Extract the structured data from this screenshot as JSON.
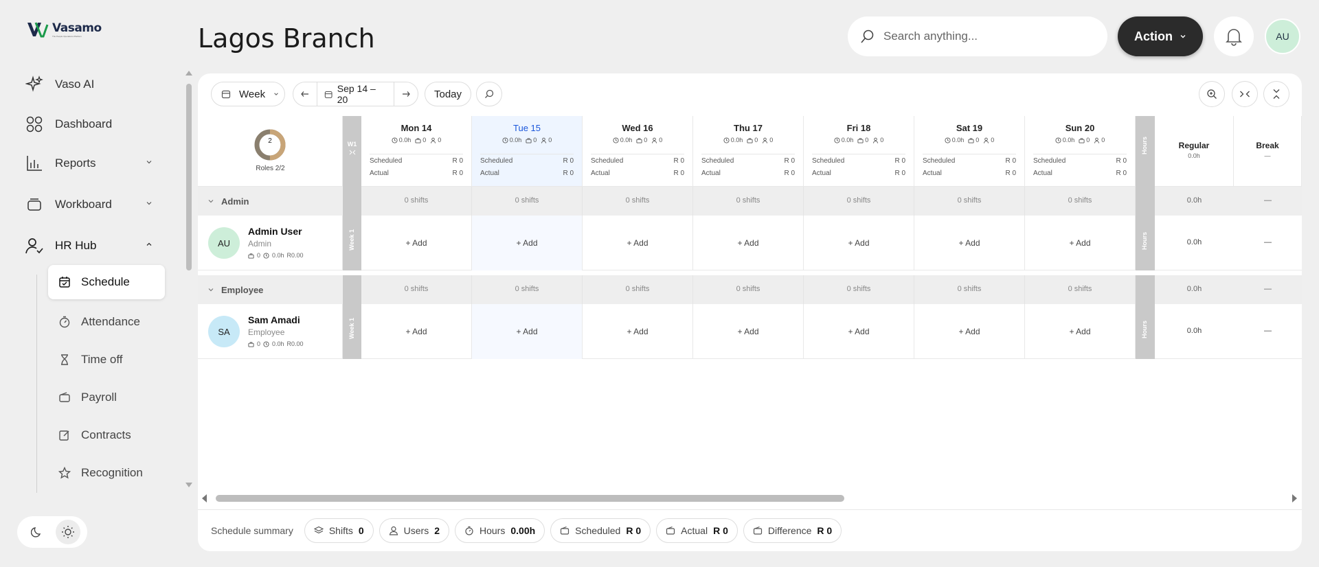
{
  "app": {
    "logo_text": "Vasamo",
    "logo_tagline": "The People Operations Platform"
  },
  "nav": {
    "vaso_ai": "Vaso AI",
    "dashboard": "Dashboard",
    "reports": "Reports",
    "workboard": "Workboard",
    "hr_hub": "HR Hub",
    "sub": {
      "schedule": "Schedule",
      "attendance": "Attendance",
      "time_off": "Time off",
      "payroll": "Payroll",
      "contracts": "Contracts",
      "recognition": "Recognition"
    }
  },
  "header": {
    "title": "Lagos Branch",
    "search_placeholder": "Search anything...",
    "action_label": "Action",
    "avatar_initials": "AU"
  },
  "toolbar": {
    "view": "Week",
    "range": "Sep 14 – 20",
    "today": "Today"
  },
  "roles": {
    "count": "2",
    "label": "Roles 2/2",
    "ring_fraction": 1.0
  },
  "week_strip": {
    "short": "W1",
    "label": "Week 1"
  },
  "hours_strip": "Hours",
  "days": [
    {
      "name": "Mon 14",
      "hours": "0.0h",
      "shifts": "0",
      "people": "0",
      "scheduled_label": "Scheduled",
      "scheduled": "R 0",
      "actual_label": "Actual",
      "actual": "R 0",
      "today": false
    },
    {
      "name": "Tue 15",
      "hours": "0.0h",
      "shifts": "0",
      "people": "0",
      "scheduled_label": "Scheduled",
      "scheduled": "R 0",
      "actual_label": "Actual",
      "actual": "R 0",
      "today": true
    },
    {
      "name": "Wed 16",
      "hours": "0.0h",
      "shifts": "0",
      "people": "0",
      "scheduled_label": "Scheduled",
      "scheduled": "R 0",
      "actual_label": "Actual",
      "actual": "R 0",
      "today": false
    },
    {
      "name": "Thu 17",
      "hours": "0.0h",
      "shifts": "0",
      "people": "0",
      "scheduled_label": "Scheduled",
      "scheduled": "R 0",
      "actual_label": "Actual",
      "actual": "R 0",
      "today": false
    },
    {
      "name": "Fri 18",
      "hours": "0.0h",
      "shifts": "0",
      "people": "0",
      "scheduled_label": "Scheduled",
      "scheduled": "R 0",
      "actual_label": "Actual",
      "actual": "R 0",
      "today": false
    },
    {
      "name": "Sat 19",
      "hours": "0.0h",
      "shifts": "0",
      "people": "0",
      "scheduled_label": "Scheduled",
      "scheduled": "R 0",
      "actual_label": "Actual",
      "actual": "R 0",
      "today": false
    },
    {
      "name": "Sun 20",
      "hours": "0.0h",
      "shifts": "0",
      "people": "0",
      "scheduled_label": "Scheduled",
      "scheduled": "R 0",
      "actual_label": "Actual",
      "actual": "R 0",
      "today": false
    }
  ],
  "summary_cols": {
    "regular": "Regular",
    "regular_val": "0.0h",
    "break": "Break",
    "break_val": "—"
  },
  "groups": [
    {
      "name": "Admin",
      "shifts_text": "0 shifts",
      "regular": "0.0h",
      "break": "—",
      "employee": {
        "initials": "AU",
        "name": "Admin User",
        "role": "Admin",
        "shifts": "0",
        "hours": "0.0h",
        "pay": "R0.00",
        "add": "+ Add",
        "regular": "0.0h",
        "break": "—"
      }
    },
    {
      "name": "Employee",
      "shifts_text": "0 shifts",
      "regular": "0.0h",
      "break": "—",
      "employee": {
        "initials": "SA",
        "name": "Sam Amadi",
        "role": "Employee",
        "shifts": "0",
        "hours": "0.0h",
        "pay": "R0.00",
        "add": "+ Add",
        "regular": "0.0h",
        "break": "—"
      }
    }
  ],
  "summary": {
    "label": "Schedule summary",
    "shifts_label": "Shifts",
    "shifts": "0",
    "users_label": "Users",
    "users": "2",
    "hours_label": "Hours",
    "hours": "0.00h",
    "scheduled_label": "Scheduled",
    "scheduled": "R 0",
    "actual_label": "Actual",
    "actual": "R 0",
    "difference_label": "Difference",
    "difference": "R 0"
  },
  "colors": {
    "accent": "#1a56db",
    "today_bg": "#eef5ff",
    "avatar_green": "#cdeed9",
    "avatar_blue": "#c7e9f7",
    "strip": "#c9c9c9"
  }
}
